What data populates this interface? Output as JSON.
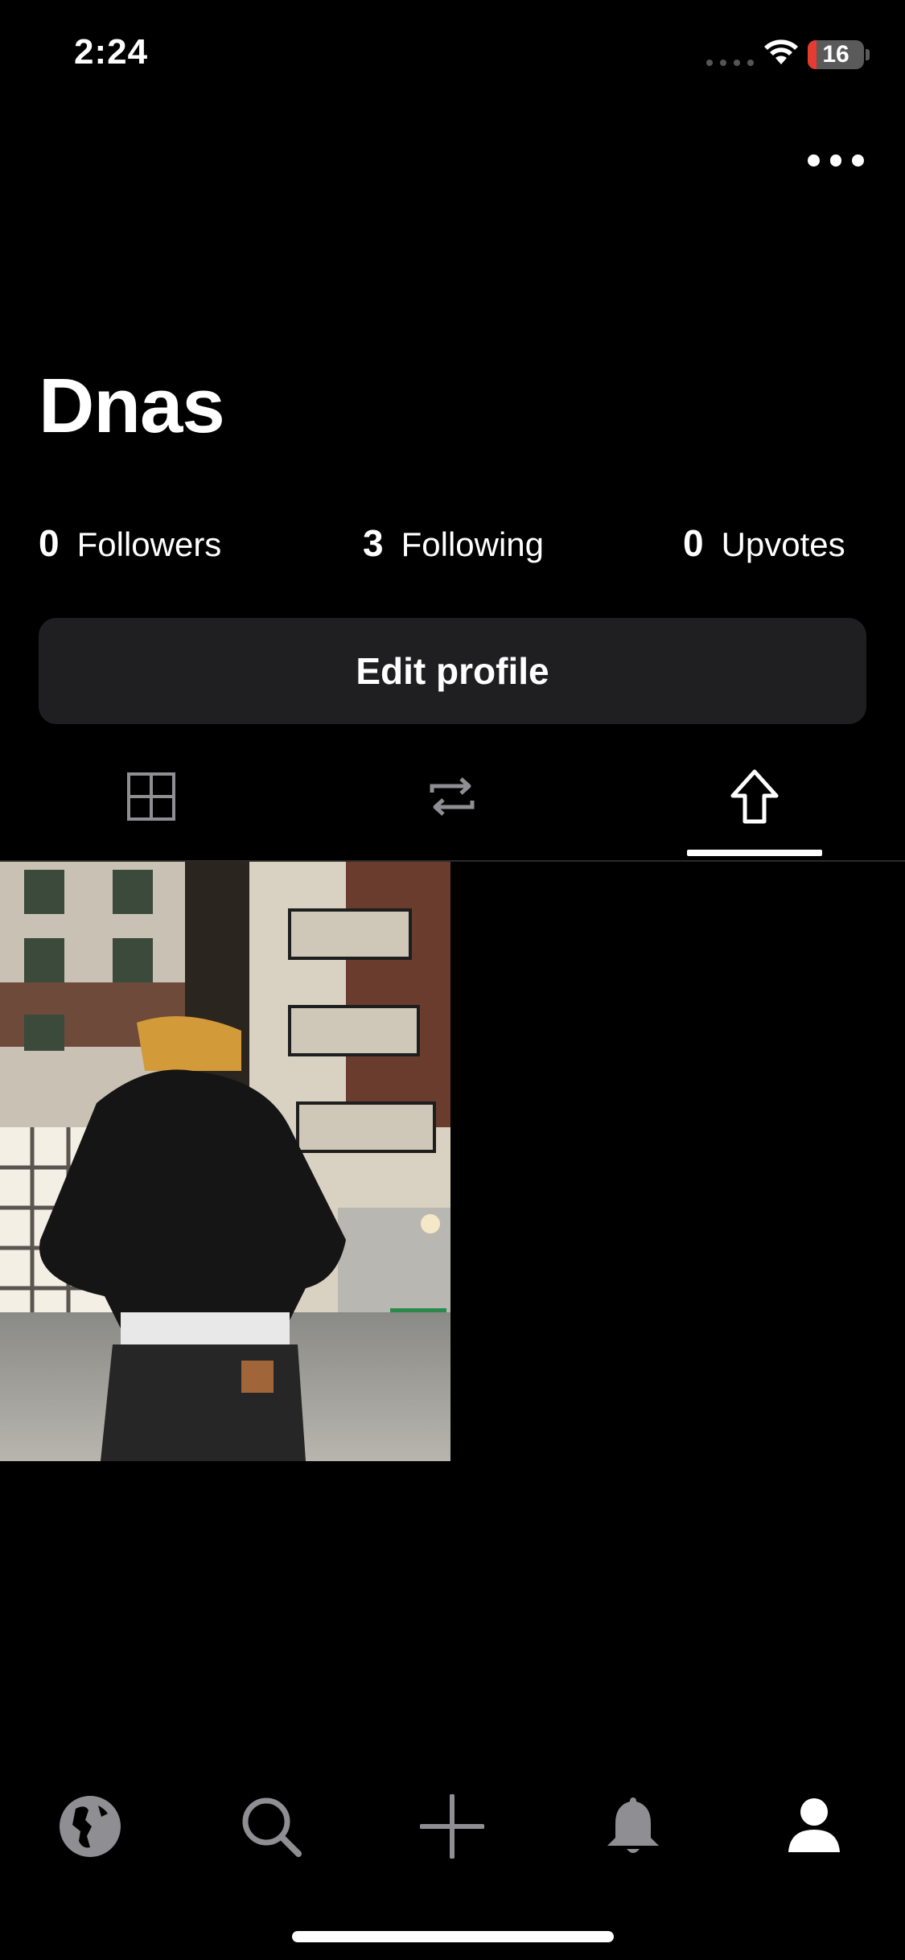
{
  "status_bar": {
    "time": "2:24",
    "battery_level": "16",
    "battery_fraction": 0.16
  },
  "profile": {
    "username": "Dnas",
    "stats": [
      {
        "value": "0",
        "label": "Followers"
      },
      {
        "value": "3",
        "label": "Following"
      },
      {
        "value": "0",
        "label": "Upvotes"
      }
    ],
    "edit_button_label": "Edit profile"
  },
  "tabs": [
    {
      "icon": "grid-icon",
      "active": false
    },
    {
      "icon": "repost-icon",
      "active": false
    },
    {
      "icon": "upvote-arrow-icon",
      "active": true
    }
  ],
  "posts": [
    {
      "kind": "image",
      "description_icon": "photo-thumbnail"
    }
  ],
  "bottom_nav": [
    {
      "icon": "globe-icon",
      "active": false
    },
    {
      "icon": "search-icon",
      "active": false
    },
    {
      "icon": "plus-icon",
      "active": false
    },
    {
      "icon": "bell-icon",
      "active": false
    },
    {
      "icon": "profile-icon",
      "active": true
    }
  ],
  "colors": {
    "background": "#000000",
    "button_bg": "#1f1f21",
    "inactive_icon": "#8e8e93",
    "battery_low": "#e53b30"
  }
}
